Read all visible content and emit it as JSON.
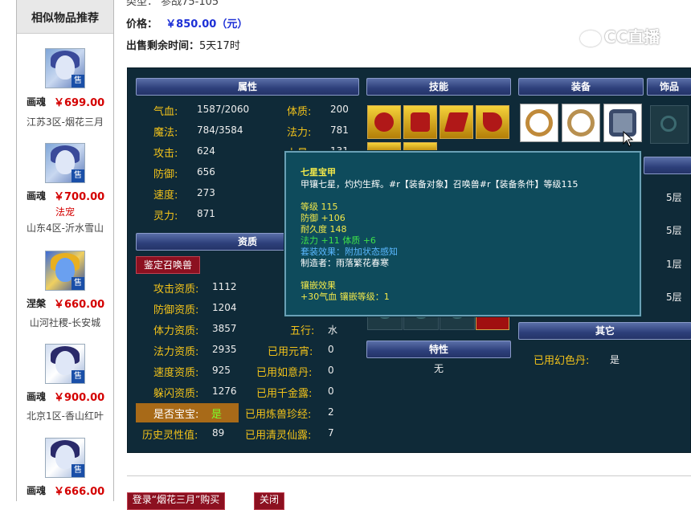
{
  "sidebar": {
    "title": "相似物品推荐",
    "products": [
      {
        "name": "画魂",
        "price": "￥699.00",
        "tag": "",
        "server": "江苏3区-烟花三月",
        "sell": "售"
      },
      {
        "name": "画魂",
        "price": "￥700.00",
        "tag": "法宠",
        "server": "山东4区-沂水雪山",
        "sell": "售"
      },
      {
        "name": "涅槃",
        "price": "￥660.00",
        "tag": "",
        "server": "山河社稷-长安城",
        "sell": "售"
      },
      {
        "name": "画魂",
        "price": "￥900.00",
        "tag": "",
        "server": "北京1区-香山红叶",
        "sell": "售"
      },
      {
        "name": "画魂",
        "price": "￥666.00",
        "tag": "",
        "server": "",
        "sell": "售"
      }
    ]
  },
  "detail": {
    "type_row": "类型：  参战75-105",
    "price_label": "价格：",
    "price_value": "￥850.00（元）",
    "time_label": "出售剩余时间：",
    "time_value": "5天17时"
  },
  "watermark": "CC直播",
  "panel": {
    "headers": {
      "attr": "属性",
      "skill": "技能",
      "equip": "装备",
      "ornament": "饰品",
      "aptitude": "资质",
      "trait": "特性",
      "other": "其它"
    },
    "attrs": [
      {
        "label": "气血:",
        "value": "1587/2060"
      },
      {
        "label": "魔法:",
        "value": "784/3584"
      },
      {
        "label": "攻击:",
        "value": "624"
      },
      {
        "label": "防御:",
        "value": "656"
      },
      {
        "label": "速度:",
        "value": "273"
      },
      {
        "label": "灵力:",
        "value": "871"
      }
    ],
    "attrs2": [
      {
        "label": "体质:",
        "value": "200"
      },
      {
        "label": "法力:",
        "value": "781"
      },
      {
        "label": "力量:",
        "value": "131"
      }
    ],
    "identify_button": "鉴定召唤兽",
    "aptitudes": [
      {
        "label": "攻击资质:",
        "value": "1112"
      },
      {
        "label": "防御资质:",
        "value": "1204"
      },
      {
        "label": "体力资质:",
        "value": "3857"
      },
      {
        "label": "法力资质:",
        "value": "2935"
      },
      {
        "label": "速度资质:",
        "value": "925"
      },
      {
        "label": "躲闪资质:",
        "value": "1276"
      }
    ],
    "baby_label": "是否宝宝:",
    "baby_value": "是",
    "history_label": "历史灵性值:",
    "history_value": "89",
    "right_col": [
      {
        "label": "五行:",
        "value": "水"
      },
      {
        "label": "已用元宵:",
        "value": "0"
      },
      {
        "label": "已用如意丹:",
        "value": "0"
      },
      {
        "label": "已用千金露:",
        "value": "0"
      },
      {
        "label": "已用炼兽珍经:",
        "value": "2"
      },
      {
        "label": "已用清灵仙露:",
        "value": "7"
      }
    ],
    "trait_value": "无",
    "layers": [
      "5层",
      "5层",
      "1层",
      "5层"
    ],
    "other_label": "已用幻色丹:",
    "other_value": "是"
  },
  "tooltip": {
    "title": "七星宝甲",
    "desc": "甲镶七星，灼灼生辉。#r【装备对象】召唤兽#r【装备条件】等级115",
    "lines": [
      {
        "text": "等级 115",
        "color": "#f2e84a"
      },
      {
        "text": "防御 +106",
        "color": "#f2e84a"
      },
      {
        "text": "耐久度 148",
        "color": "#f2e84a"
      },
      {
        "text": "法力 +11  体质 +6",
        "color": "#3ee04a"
      },
      {
        "text": "套装效果：附加状态感知",
        "color": "#5ab8ff"
      },
      {
        "text": "制造者：雨落繁花春寒",
        "color": "#ffffff"
      }
    ],
    "inlay_title": "镶嵌效果",
    "inlay_line": "+30气血  镶嵌等级：1"
  },
  "bottom_buttons": [
    "登录“烟花三月”购买",
    "关闭"
  ]
}
